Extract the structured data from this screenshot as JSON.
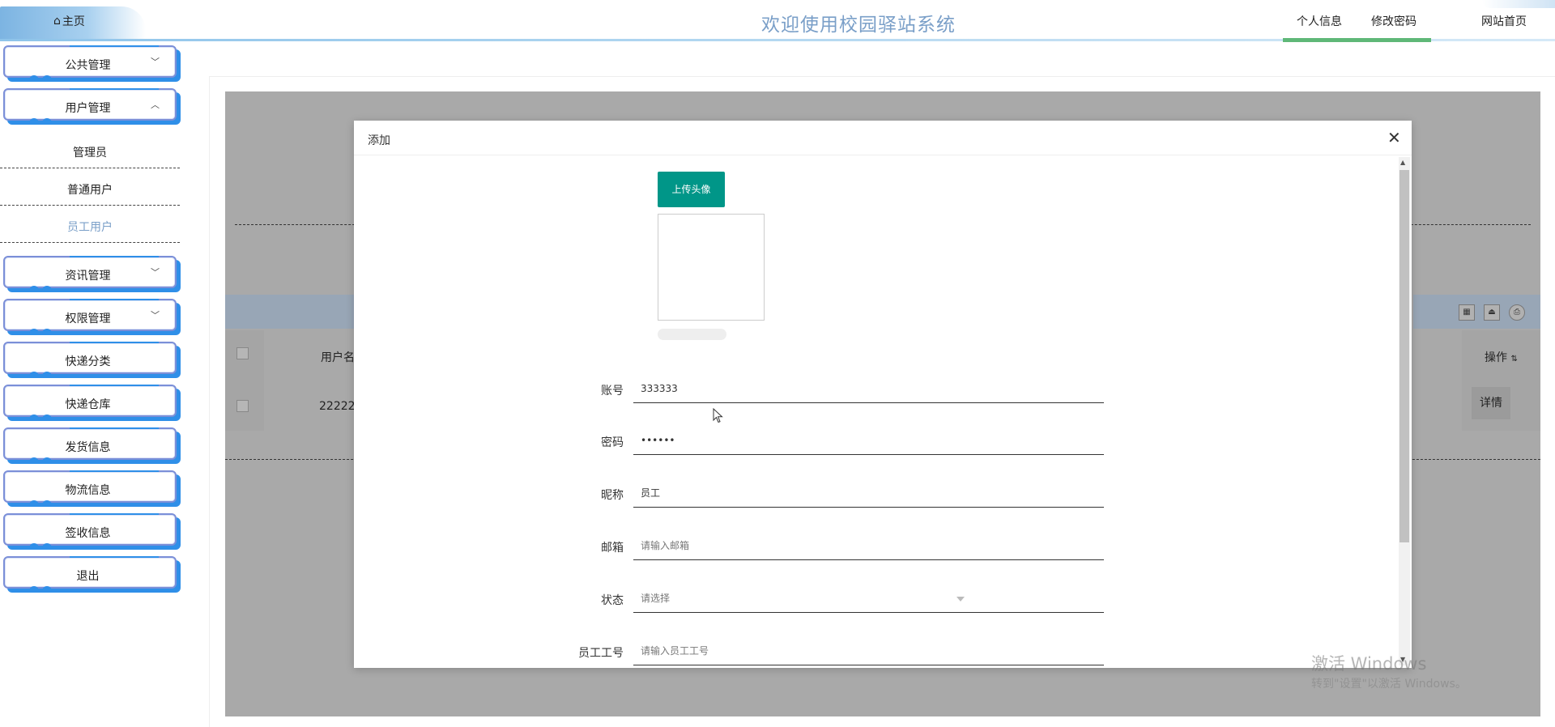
{
  "header": {
    "home_label": "主页",
    "title": "欢迎使用校园驿站系统",
    "nav": [
      "个人信息",
      "修改密码",
      "网站首页"
    ]
  },
  "sidebar": {
    "menus": [
      {
        "label": "公共管理",
        "chevron": "chevron-down"
      },
      {
        "label": "用户管理",
        "chevron": "chevron-up"
      },
      {
        "label": "资讯管理",
        "chevron": "chevron-down"
      },
      {
        "label": "权限管理",
        "chevron": "chevron-down"
      },
      {
        "label": "快递分类"
      },
      {
        "label": "快递仓库"
      },
      {
        "label": "发货信息"
      },
      {
        "label": "物流信息"
      },
      {
        "label": "签收信息"
      },
      {
        "label": "退出"
      }
    ],
    "user_submenu": [
      "管理员",
      "普通用户",
      "员工用户"
    ],
    "active_submenu": "员工用户"
  },
  "background_table": {
    "col_username_partial": "用户名",
    "row_username_partial": "22222",
    "col_actions": "操作",
    "detail_button": "详情"
  },
  "modal": {
    "title": "添加",
    "upload_button": "上传头像",
    "fields": [
      {
        "label": "账号",
        "value": "333333",
        "placeholder": ""
      },
      {
        "label": "密码",
        "value": "••••••",
        "placeholder": ""
      },
      {
        "label": "昵称",
        "value": "员工",
        "placeholder": ""
      },
      {
        "label": "邮箱",
        "value": "",
        "placeholder": "请输入邮箱"
      },
      {
        "label": "状态",
        "value": "",
        "placeholder": "请选择"
      },
      {
        "label": "员工工号",
        "value": "",
        "placeholder": "请输入员工工号"
      }
    ]
  },
  "watermark": {
    "line1": "激活 Windows",
    "line2": "转到\"设置\"以激活 Windows。"
  },
  "colors": {
    "accent_green": "#009688",
    "title_blue": "#7a9fc8",
    "menu_shadow_blue": "#2f8fe8",
    "nav_underline": "#5fb878"
  }
}
